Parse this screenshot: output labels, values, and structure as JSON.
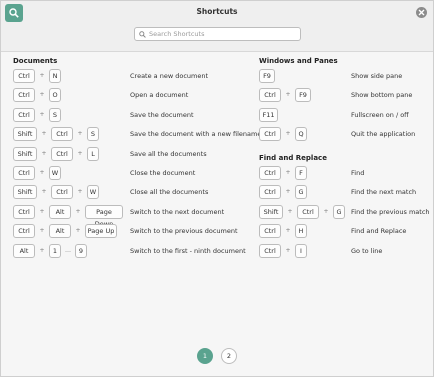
{
  "window": {
    "title": "Shortcuts",
    "close_icon": "close-icon",
    "search_icon": "search-icon"
  },
  "search": {
    "placeholder": "Search Shortcuts",
    "value": ""
  },
  "sections": {
    "documents": {
      "title": "Documents",
      "items": [
        {
          "keys": [
            "Ctrl",
            "N"
          ],
          "desc": "Create a new document"
        },
        {
          "keys": [
            "Ctrl",
            "O"
          ],
          "desc": "Open a document"
        },
        {
          "keys": [
            "Ctrl",
            "S"
          ],
          "desc": "Save the document"
        },
        {
          "keys": [
            "Shift",
            "Ctrl",
            "S"
          ],
          "desc": "Save the document with a new filename"
        },
        {
          "keys": [
            "Shift",
            "Ctrl",
            "L"
          ],
          "desc": "Save all the documents"
        },
        {
          "keys": [
            "Ctrl",
            "W"
          ],
          "desc": "Close the document"
        },
        {
          "keys": [
            "Shift",
            "Ctrl",
            "W"
          ],
          "desc": "Close all the documents"
        },
        {
          "keys": [
            "Ctrl",
            "Alt",
            "Page Down"
          ],
          "desc": "Switch to the next document"
        },
        {
          "keys": [
            "Ctrl",
            "Alt",
            "Page Up"
          ],
          "desc": "Switch to the previous document"
        },
        {
          "keys": [
            "Alt",
            "1",
            "9"
          ],
          "desc": "Switch to the first - ninth document"
        }
      ]
    },
    "windows": {
      "title": "Windows and Panes",
      "items": [
        {
          "keys": [
            "F9"
          ],
          "desc": "Show side pane"
        },
        {
          "keys": [
            "Ctrl",
            "F9"
          ],
          "desc": "Show bottom pane"
        },
        {
          "keys": [
            "F11"
          ],
          "desc": "Fullscreen on / off"
        },
        {
          "keys": [
            "Ctrl",
            "Q"
          ],
          "desc": "Quit the application"
        }
      ]
    },
    "find": {
      "title": "Find and Replace",
      "items": [
        {
          "keys": [
            "Ctrl",
            "F"
          ],
          "desc": "Find"
        },
        {
          "keys": [
            "Ctrl",
            "G"
          ],
          "desc": "Find the next match"
        },
        {
          "keys": [
            "Shift",
            "Ctrl",
            "G"
          ],
          "desc": "Find the previous match"
        },
        {
          "keys": [
            "Ctrl",
            "H"
          ],
          "desc": "Find and Replace"
        },
        {
          "keys": [
            "Ctrl",
            "I"
          ],
          "desc": "Go to line"
        }
      ]
    }
  },
  "separators": {
    "plus": "+",
    "range": "…"
  },
  "pagination": {
    "pages": [
      "1",
      "2"
    ],
    "active": "1"
  },
  "colors": {
    "accent": "#5aa38f"
  }
}
